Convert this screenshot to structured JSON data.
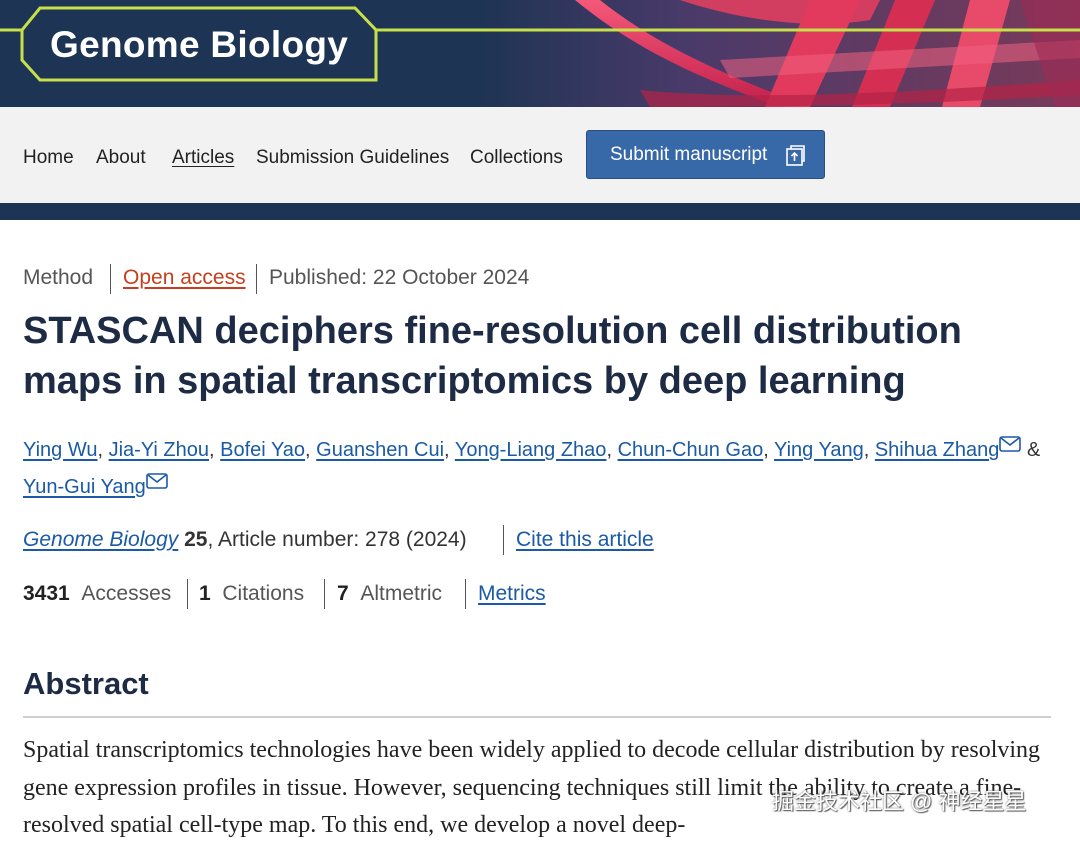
{
  "header": {
    "brand": "Genome Biology"
  },
  "nav": {
    "items": [
      "Home",
      "About",
      "Articles",
      "Submission Guidelines",
      "Collections"
    ],
    "active": "Articles",
    "submit_label": "Submit manuscript"
  },
  "article": {
    "type": "Method",
    "access": "Open access",
    "published": "Published: 22 October 2024",
    "title": "STASCAN deciphers fine-resolution cell distribution maps in spatial transcriptomics by deep learning",
    "authors": [
      "Ying Wu",
      "Jia-Yi Zhou",
      "Bofei Yao",
      "Guanshen Cui",
      "Yong-Liang Zhao",
      "Chun-Chun Gao",
      "Ying Yang",
      "Shihua Zhang",
      "Yun-Gui Yang"
    ],
    "author_separator": ",",
    "last_separator": "&",
    "journal": "Genome Biology",
    "volume": "25",
    "article_number": ", Article number: 278 (2024)",
    "cite_label": "Cite this article"
  },
  "metrics": {
    "accesses_value": "3431",
    "accesses_label": "Accesses",
    "citations_value": "1",
    "citations_label": "Citations",
    "altmetric_value": "7",
    "altmetric_label": "Altmetric",
    "metrics_link": "Metrics"
  },
  "abstract": {
    "heading": "Abstract",
    "text": "Spatial transcriptomics technologies have been widely applied to decode cellular distribution by resolving gene expression profiles in tissue. However, sequencing techniques still limit the ability to create a fine-resolved spatial cell-type map. To this end, we develop a novel deep-"
  },
  "watermark": "掘金技术社区 @ 神经星星",
  "icons": [
    "external-submit-icon",
    "mail-icon"
  ],
  "colors": {
    "header_bg": "#1e3454",
    "accent_lime": "#c6e04a",
    "link": "#1a5aa6",
    "open_access": "#c4401e",
    "button": "#3768a8"
  }
}
